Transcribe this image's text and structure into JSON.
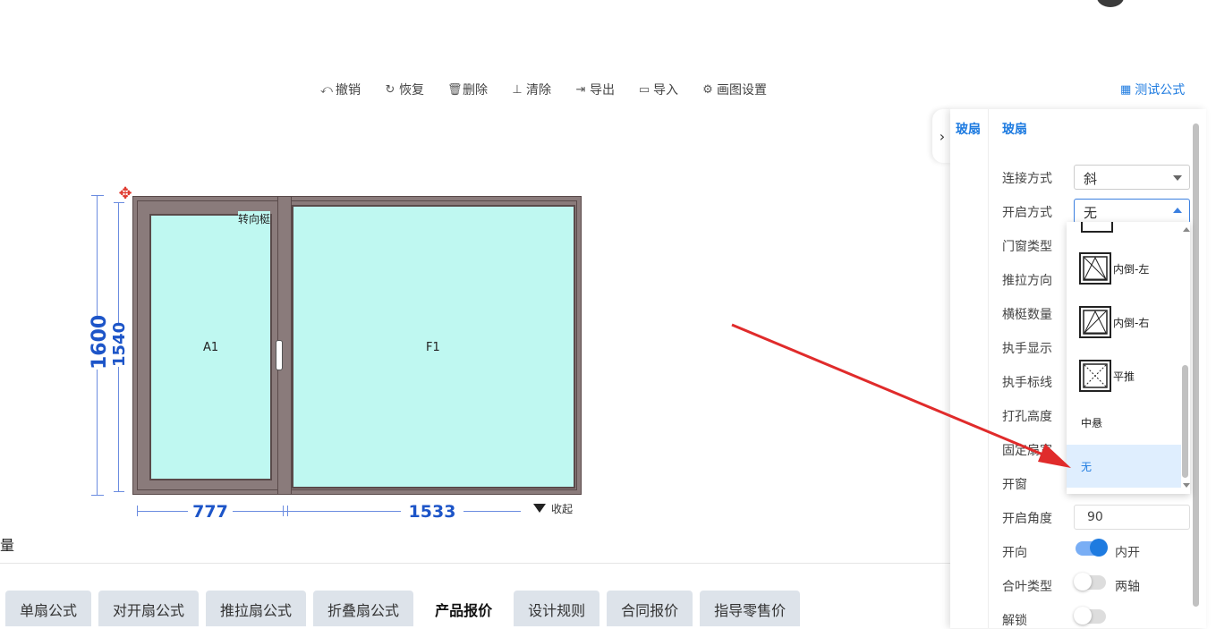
{
  "toolbar": {
    "undo": {
      "icon": "undo-icon",
      "label": "撤销"
    },
    "redo": {
      "icon": "redo-icon",
      "label": "恢复"
    },
    "delete": {
      "icon": "trash-icon",
      "label": "删除"
    },
    "clear": {
      "icon": "broom-icon",
      "label": "清除"
    },
    "export": {
      "icon": "export-icon",
      "label": "导出"
    },
    "import": {
      "icon": "folder-open-icon",
      "label": "导入"
    },
    "settings": {
      "icon": "gear-icon",
      "label": "画图设置"
    }
  },
  "test_formula": {
    "icon": "calculator-icon",
    "label": "测试公式"
  },
  "drawing": {
    "height_outer": "1600",
    "height_inner": "1540",
    "width_left": "777",
    "width_right": "1533",
    "pane_left_label": "A1",
    "pane_right_label": "F1",
    "mullion_label": "转向梃",
    "collapse_label": "收起"
  },
  "section_label": "量",
  "tabs": [
    {
      "label": "单扇公式",
      "active": false
    },
    {
      "label": "对开扇公式",
      "active": false
    },
    {
      "label": "推拉扇公式",
      "active": false
    },
    {
      "label": "折叠扇公式",
      "active": false
    },
    {
      "label": "产品报价",
      "active": true
    },
    {
      "label": "设计规则",
      "active": false
    },
    {
      "label": "合同报价",
      "active": false
    },
    {
      "label": "指导零售价",
      "active": false
    }
  ],
  "panel": {
    "side_tab": "玻扇",
    "title": "玻扇",
    "fields": {
      "connection": {
        "label": "连接方式",
        "value": "斜"
      },
      "opening": {
        "label": "开启方式",
        "value": "无"
      },
      "door_type": {
        "label": "门窗类型"
      },
      "slide_dir": {
        "label": "推拉方向"
      },
      "rail_count": {
        "label": "横梃数量"
      },
      "handle_show": {
        "label": "执手显示"
      },
      "handle_line": {
        "label": "执手标线"
      },
      "hole_height": {
        "label": "打孔高度"
      },
      "fixed_width": {
        "label": "固定扇宽"
      },
      "open_window": {
        "label": "开窗"
      },
      "open_angle": {
        "label": "开启角度",
        "value": "90"
      },
      "open_dir": {
        "label": "开向",
        "switch_label": "内开",
        "on": true
      },
      "hinge_type": {
        "label": "合叶类型",
        "switch_label": "两轴",
        "on": false
      },
      "unlock": {
        "label": "解锁",
        "on": false
      }
    }
  },
  "dropdown": {
    "options": [
      {
        "label": "内倒-左",
        "icon": "tilt-left-icon"
      },
      {
        "label": "内倒-右",
        "icon": "tilt-right-icon"
      },
      {
        "label": "平推",
        "icon": "parallel-push-icon"
      },
      {
        "label": "中悬",
        "icon": ""
      },
      {
        "label": "无",
        "icon": "",
        "selected": true
      }
    ]
  },
  "colors": {
    "accent": "#1e7be0",
    "glass": "#bff8f1",
    "frame": "#8a7b7b",
    "dimension": "#1d55c8",
    "arrow": "#e02b2b"
  }
}
